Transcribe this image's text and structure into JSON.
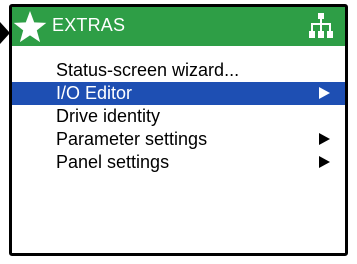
{
  "header": {
    "title": "EXTRAS",
    "icons": [
      "star-icon",
      "tree-structure-icon"
    ],
    "background_color": "#2e9e46"
  },
  "menu": {
    "items": [
      {
        "label": "Status-screen wizard...",
        "has_submenu": false,
        "selected": false
      },
      {
        "label": "I/O Editor",
        "has_submenu": true,
        "selected": true
      },
      {
        "label": "Drive identity",
        "has_submenu": false,
        "selected": false
      },
      {
        "label": "Parameter settings",
        "has_submenu": true,
        "selected": false
      },
      {
        "label": "Panel settings",
        "has_submenu": true,
        "selected": false
      }
    ],
    "selection_color": "#1e4fb3"
  }
}
